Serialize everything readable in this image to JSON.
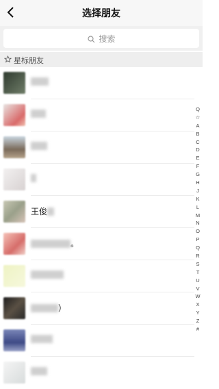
{
  "nav": {
    "title": "选择朋友"
  },
  "search": {
    "placeholder": "搜索"
  },
  "section": {
    "label": "星标朋友"
  },
  "contacts": [
    {
      "name": ""
    },
    {
      "name": ""
    },
    {
      "name": ""
    },
    {
      "name": ""
    },
    {
      "name": "王俊"
    },
    {
      "name": "。"
    },
    {
      "name": ""
    },
    {
      "name": "）"
    },
    {
      "name": ""
    },
    {
      "name": ""
    }
  ],
  "index_letters": [
    "Q",
    "☆",
    "A",
    "B",
    "C",
    "D",
    "E",
    "F",
    "G",
    "H",
    "J",
    "K",
    "L",
    "M",
    "N",
    "O",
    "P",
    "Q",
    "R",
    "S",
    "T",
    "U",
    "V",
    "W",
    "X",
    "Y",
    "Z",
    "#"
  ]
}
